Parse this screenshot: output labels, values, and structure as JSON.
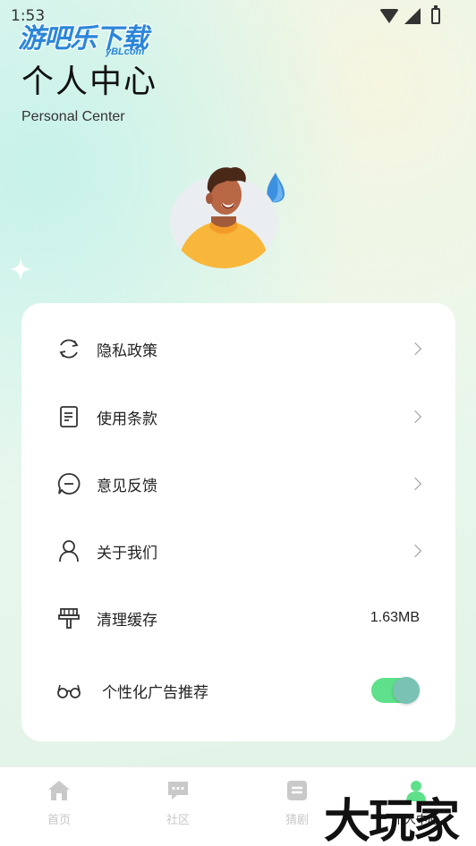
{
  "status_bar": {
    "time": "1:53"
  },
  "watermark": {
    "name": "游吧乐下载",
    "url": "yBLcom",
    "corner": "大玩家"
  },
  "header": {
    "title": "个人中心",
    "subtitle": "Personal Center"
  },
  "menu": {
    "items": [
      {
        "label": "隐私政策",
        "icon": "refresh-icon"
      },
      {
        "label": "使用条款",
        "icon": "document-icon"
      },
      {
        "label": "意见反馈",
        "icon": "chat-bubble-icon"
      },
      {
        "label": "关于我们",
        "icon": "person-icon"
      }
    ],
    "cache": {
      "label": "清理缓存",
      "value": "1.63MB",
      "icon": "brush-icon"
    },
    "ads": {
      "label": "个性化广告推荐",
      "icon": "glasses-icon",
      "enabled": true
    }
  },
  "tab_bar": {
    "tabs": [
      {
        "label": "首页",
        "icon": "home-icon"
      },
      {
        "label": "社区",
        "icon": "message-icon"
      },
      {
        "label": "猜剧",
        "icon": "list-icon"
      },
      {
        "label": "个人中心",
        "icon": "profile-icon",
        "active": true
      }
    ]
  },
  "colors": {
    "accent": "#5fe08a",
    "knob": "#79c2b4",
    "background": "#e3f7ee"
  }
}
